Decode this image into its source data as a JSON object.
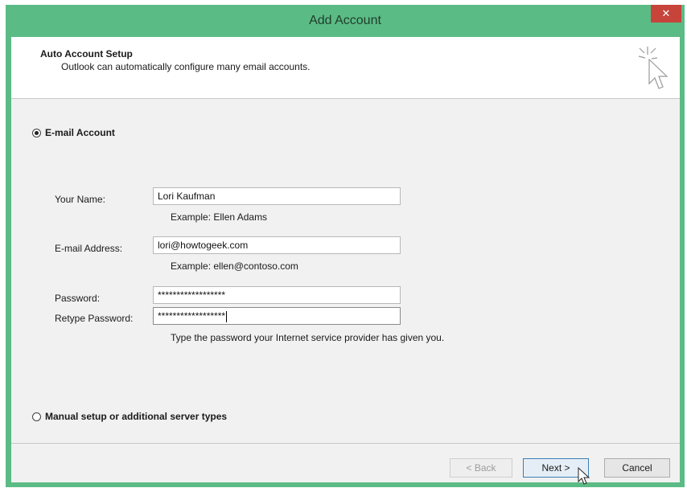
{
  "window": {
    "title": "Add Account",
    "close_glyph": "✕"
  },
  "header": {
    "title": "Auto Account Setup",
    "subtitle": "Outlook can automatically configure many email accounts.",
    "icon": "wizard-cursor-icon"
  },
  "email_option": {
    "label": "E-mail Account",
    "selected": true
  },
  "form": {
    "name_label": "Your Name:",
    "name_value": "Lori Kaufman",
    "name_example": "Example: Ellen Adams",
    "email_label": "E-mail Address:",
    "email_value": "lori@howtogeek.com",
    "email_example": "Example: ellen@contoso.com",
    "password_label": "Password:",
    "password_value": "******************",
    "retype_label": "Retype Password:",
    "retype_value": "******************",
    "password_hint": "Type the password your Internet service provider has given you."
  },
  "manual_option": {
    "label": "Manual setup or additional server types",
    "selected": false
  },
  "buttons": {
    "back": "< Back",
    "next": "Next >",
    "cancel": "Cancel"
  },
  "colors": {
    "titlebar": "#5bbb85",
    "close": "#c7443a",
    "client": "#f1f1f1"
  }
}
